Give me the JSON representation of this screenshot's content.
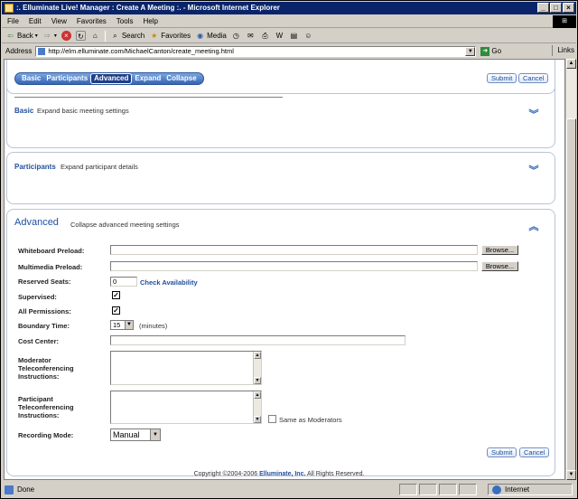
{
  "window": {
    "title": ":. Elluminate Live! Manager : Create A Meeting :. - Microsoft Internet Explorer"
  },
  "menu": [
    "File",
    "Edit",
    "View",
    "Favorites",
    "Tools",
    "Help"
  ],
  "toolbar": {
    "back": "Back",
    "search": "Search",
    "favorites": "Favorites",
    "media": "Media"
  },
  "address": {
    "label": "Address",
    "url": "http://elm.elluminate.com/MichaelCanton/create_meeting.html",
    "go": "Go",
    "links": "Links"
  },
  "status": {
    "text": "Done",
    "zone": "Internet"
  },
  "tabs": [
    "Basic",
    "Participants",
    "Advanced",
    "Expand",
    "Collapse"
  ],
  "buttons": {
    "submit": "Submit",
    "cancel": "Cancel",
    "browse": "Browse..."
  },
  "sections": {
    "basic": {
      "title": "Basic",
      "desc": "Expand basic meeting settings"
    },
    "participants": {
      "title": "Participants",
      "desc": "Expand participant details"
    },
    "advanced": {
      "title": "Advanced",
      "desc": "Collapse advanced meeting settings"
    }
  },
  "form": {
    "whiteboard": "Whiteboard Preload:",
    "multimedia": "Multimedia Preload:",
    "reserved": "Reserved Seats:",
    "reserved_value": "0",
    "check": "Check Availability",
    "supervised": "Supervised:",
    "permissions": "All Permissions:",
    "boundary": "Boundary Time:",
    "boundary_value": "15",
    "minutes": "(minutes)",
    "cost": "Cost Center:",
    "moderator": [
      "Moderator",
      "Teleconferencing",
      "Instructions:"
    ],
    "participant": [
      "Participant",
      "Teleconferencing",
      "Instructions:"
    ],
    "same": "Same as Moderators",
    "recording": "Recording Mode:",
    "recording_value": "Manual"
  },
  "footer": {
    "prefix": "Copyright ©2004-2006",
    "company": "Elluminate, Inc.",
    "suffix": "All Rights Reserved."
  }
}
